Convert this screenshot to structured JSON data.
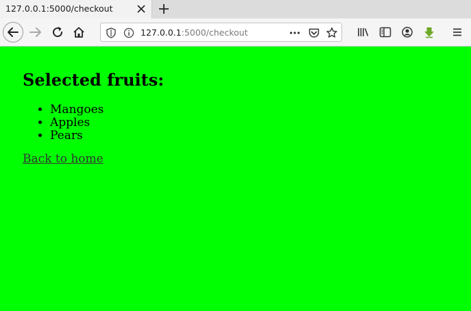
{
  "browser": {
    "tab": {
      "title": "127.0.0.1:5000/checkout"
    },
    "url": {
      "host": "127.0.0.1",
      "rest": ":5000/checkout"
    }
  },
  "page": {
    "heading": "Selected fruits:",
    "fruits": [
      "Mangoes",
      "Apples",
      "Pears"
    ],
    "back_link": "Back to home",
    "background_color": "#00ff00"
  }
}
